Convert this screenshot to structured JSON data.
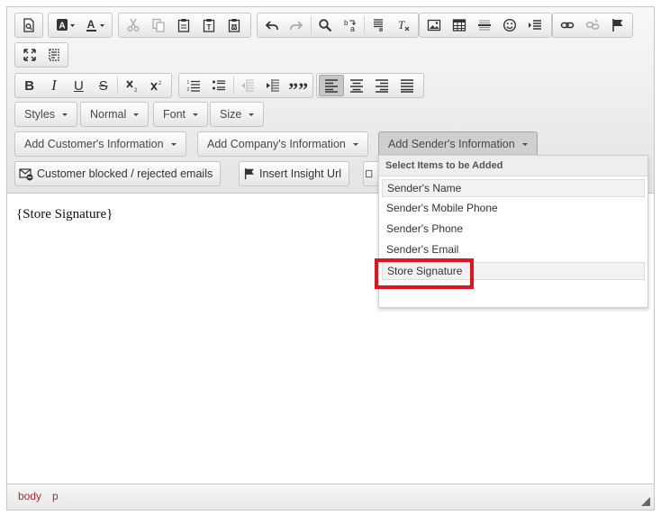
{
  "toolbar": {
    "row3": {
      "styles": "Styles",
      "format": "Normal",
      "font": "Font",
      "size": "Size"
    },
    "row4": {
      "customer": "Add Customer's Information",
      "company": "Add Company's Information",
      "sender": "Add Sender's Information"
    },
    "row5": {
      "blocked": "Customer blocked / rejected emails",
      "insight": "Insight Url",
      "insight_prefix": "Insert"
    }
  },
  "content": {
    "text": "{Store Signature}"
  },
  "statusbar": {
    "path": [
      "body",
      "p"
    ]
  },
  "dropdown": {
    "title": "Select Items to be Added",
    "items": [
      "Sender's Name",
      "Sender's Mobile Phone",
      "Sender's Phone",
      "Sender's Email",
      "Store Signature"
    ]
  },
  "icons": {
    "bold": "B",
    "italic": "I",
    "underline": "U",
    "strike": "S",
    "quote": "””"
  },
  "colors": {
    "highlight": "#e0141e",
    "path": "#a52a2a"
  }
}
